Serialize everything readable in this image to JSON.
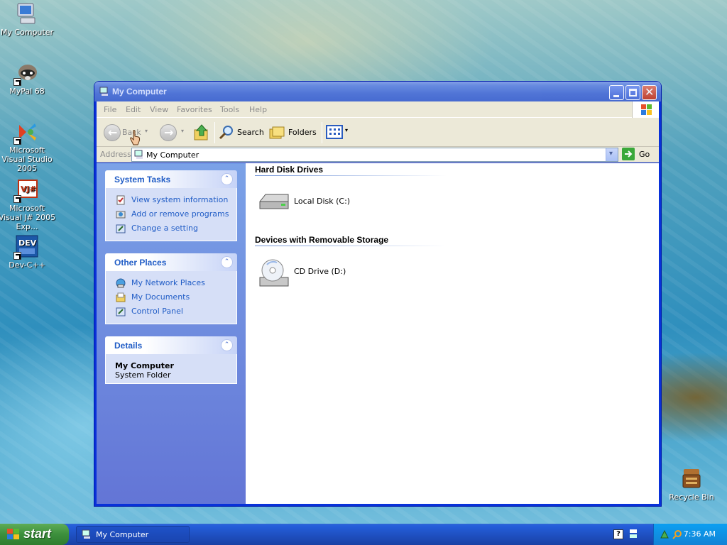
{
  "desktop": {
    "icons": [
      {
        "label": "My Computer"
      },
      {
        "label": "MyPal 68"
      },
      {
        "label": "Microsoft Visual Studio 2005"
      },
      {
        "label": "Microsoft Visual J# 2005 Exp..."
      },
      {
        "label": "Dev-C++"
      },
      {
        "label": "Recycle Bin"
      }
    ]
  },
  "window": {
    "title": "My Computer",
    "menu": [
      "File",
      "Edit",
      "View",
      "Favorites",
      "Tools",
      "Help"
    ],
    "toolbar": {
      "back_label": "Back",
      "search_label": "Search",
      "folders_label": "Folders"
    },
    "address": {
      "label": "Address",
      "value": "My Computer",
      "go_label": "Go"
    },
    "task_pane": {
      "system_tasks": {
        "title": "System Tasks",
        "items": [
          "View system information",
          "Add or remove programs",
          "Change a setting"
        ]
      },
      "other_places": {
        "title": "Other Places",
        "items": [
          "My Network Places",
          "My Documents",
          "Control Panel"
        ]
      },
      "details": {
        "title": "Details",
        "name": "My Computer",
        "type": "System Folder"
      }
    },
    "groups": [
      {
        "title": "Hard Disk Drives",
        "items": [
          "Local Disk (C:)"
        ]
      },
      {
        "title": "Devices with Removable Storage",
        "items": [
          "CD Drive (D:)"
        ]
      }
    ]
  },
  "taskbar": {
    "start_label": "start",
    "active_task": "My Computer",
    "clock": "7:36 AM"
  }
}
